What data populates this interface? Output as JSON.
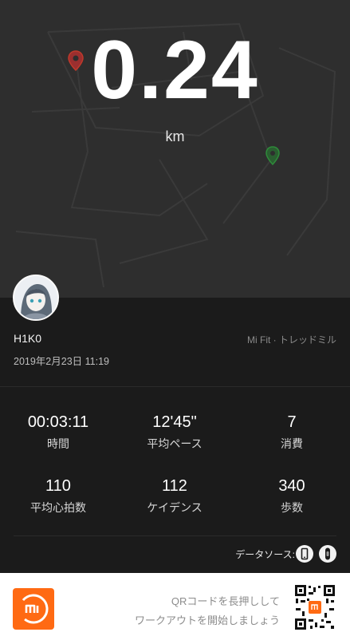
{
  "header": {
    "distance": "0.24",
    "unit": "km"
  },
  "profile": {
    "username": "H1K0",
    "source": "Mi Fit · トレッドミル",
    "datetime": "2019年2月23日 11:19"
  },
  "stats": [
    {
      "value": "00:03:11",
      "label": "時間"
    },
    {
      "value": "12'45\"",
      "label": "平均ペース"
    },
    {
      "value": "7",
      "label": "消費"
    },
    {
      "value": "110",
      "label": "平均心拍数"
    },
    {
      "value": "112",
      "label": "ケイデンス"
    },
    {
      "value": "340",
      "label": "歩数"
    }
  ],
  "data_source": {
    "label": "データソース:",
    "icons": [
      "phone-icon",
      "band-icon"
    ]
  },
  "footer": {
    "logo_icon": "mi-logo-icon",
    "qr_line1": "QRコードを長押しして",
    "qr_line2": "ワークアウトを開始しましょう"
  },
  "colors": {
    "start_pin": "#c0392b",
    "end_pin": "#2e8b3a",
    "brand": "#ff6a13"
  }
}
